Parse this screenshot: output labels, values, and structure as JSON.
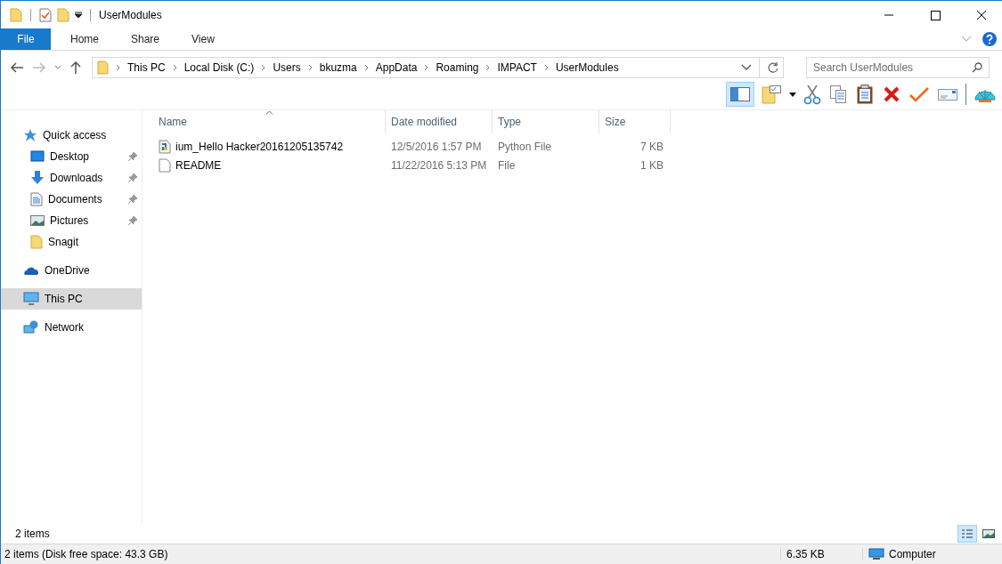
{
  "window": {
    "title": "UserModules"
  },
  "ribbon_tabs": [
    {
      "label": "File",
      "selected": true
    },
    {
      "label": "Home",
      "selected": false
    },
    {
      "label": "Share",
      "selected": false
    },
    {
      "label": "View",
      "selected": false
    }
  ],
  "address": {
    "breadcrumbs": [
      "This PC",
      "Local Disk (C:)",
      "Users",
      "bkuzma",
      "AppData",
      "Roaming",
      "IMPACT",
      "UserModules"
    ]
  },
  "search": {
    "placeholder": "Search UserModules"
  },
  "sidebar": {
    "items": [
      {
        "label": "Quick access",
        "kind": "star",
        "selected": false,
        "children": [
          {
            "label": "Desktop",
            "kind": "desktop",
            "selected": false,
            "pinned": true
          },
          {
            "label": "Downloads",
            "kind": "download",
            "selected": false,
            "pinned": true
          },
          {
            "label": "Documents",
            "kind": "document",
            "selected": false,
            "pinned": true
          },
          {
            "label": "Pictures",
            "kind": "picture",
            "selected": false,
            "pinned": true
          },
          {
            "label": "Snagit",
            "kind": "folder",
            "selected": false,
            "pinned": false
          }
        ]
      },
      {
        "label": "OneDrive",
        "kind": "cloud",
        "selected": false
      },
      {
        "label": "This PC",
        "kind": "computer",
        "selected": true
      },
      {
        "label": "Network",
        "kind": "network",
        "selected": false
      }
    ]
  },
  "table": {
    "columns": [
      "Name",
      "Date modified",
      "Type",
      "Size"
    ],
    "rows": [
      {
        "kind": "python",
        "name": "ium_Hello Hacker20161205135742",
        "date": "12/5/2016 1:57 PM",
        "type": "Python File",
        "size": "7 KB"
      },
      {
        "kind": "file",
        "name": "README",
        "date": "11/22/2016 5:13 PM",
        "type": "File",
        "size": "1 KB"
      }
    ]
  },
  "item_count": "2 items",
  "view_buttons": [
    {
      "kind": "details",
      "selected": true
    },
    {
      "kind": "tiles",
      "selected": false
    }
  ],
  "status_bar": {
    "info": "2 items (Disk free space: 43.3 GB)",
    "size": "6.35 KB",
    "location": "Computer"
  }
}
